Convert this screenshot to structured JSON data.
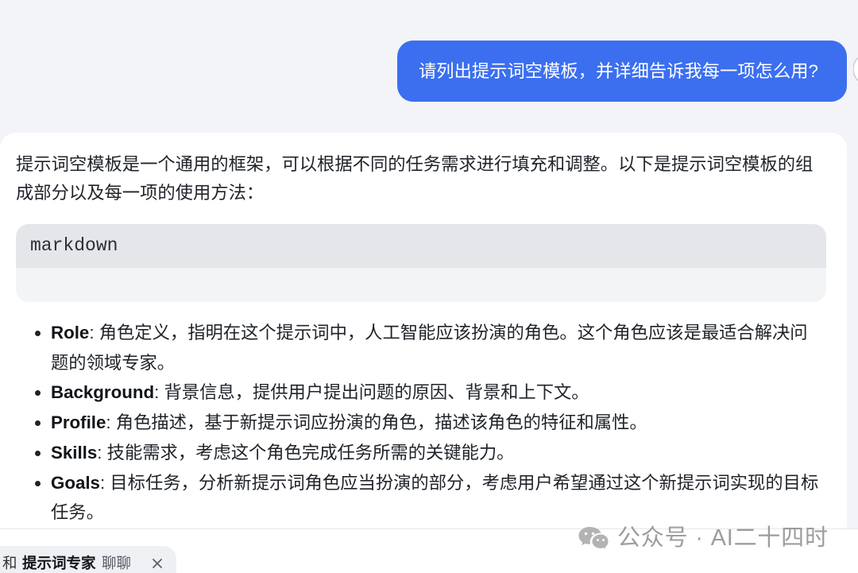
{
  "conversation": {
    "user_message": {
      "text": "请列出提示词空模板，并详细告诉我每一项怎么用?"
    },
    "assistant_message": {
      "intro": "提示词空模板是一个通用的框架，可以根据不同的任务需求进行填充和调整。以下是提示词空模板的组成部分以及每一项的使用方法：",
      "code_block": {
        "language": "markdown"
      },
      "items": [
        {
          "label": "Role",
          "description": ": 角色定义，指明在这个提示词中，人工智能应该扮演的角色。这个角色应该是最适合解决问题的领域专家。"
        },
        {
          "label": "Background",
          "description": ": 背景信息，提供用户提出问题的原因、背景和上下文。"
        },
        {
          "label": "Profile",
          "description": ": 角色描述，基于新提示词应扮演的角色，描述该角色的特征和属性。"
        },
        {
          "label": "Skills",
          "description": ": 技能需求，考虑这个角色完成任务所需的关键能力。"
        },
        {
          "label": "Goals",
          "description": ": 目标任务，分析新提示词角色应当扮演的部分，考虑用户希望通过这个新提示词实现的目标任务。"
        }
      ]
    }
  },
  "footer": {
    "agent_chip": {
      "prefix": "和",
      "agent_name": "提示词专家",
      "suffix": "聊聊",
      "close_icon": "close-icon"
    }
  },
  "watermark": {
    "icon": "wechat-icon",
    "text": "公众号 · AI二十四时"
  },
  "icons": {
    "user_avatar": "avatar-icon"
  },
  "colors": {
    "page_background": "#f2f4f7",
    "user_bubble": "#3b6ff0",
    "code_header": "#e4e6ea",
    "chip_background": "#eef0f4"
  }
}
